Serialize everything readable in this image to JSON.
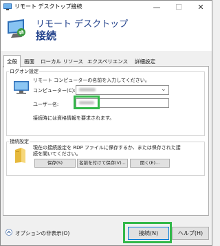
{
  "window": {
    "title": "リモート デスクトップ接続",
    "close": "✕",
    "minimize": "—",
    "maximize": "☐"
  },
  "banner": {
    "title": "リモート デスクトップ",
    "subtitle": "接続"
  },
  "tabs": [
    {
      "label": "全般",
      "active": true
    },
    {
      "label": "画面"
    },
    {
      "label": "ローカル リソース"
    },
    {
      "label": "エクスペリエンス"
    },
    {
      "label": "詳細設定"
    }
  ],
  "logon": {
    "group_label": "ログオン設定",
    "prompt": "リモート コンピューターの名前を入力してください。",
    "computer_label": "コンピューター(C):",
    "computer_value": "",
    "user_label": "ユーザー名:",
    "user_value": "",
    "note": "接続時には資格情報を要求されます。"
  },
  "connection": {
    "group_label": "接続設定",
    "text_line1": "現在の接続設定を RDP ファイルに保存するか、または保存された接",
    "text_line2": "続を開いてください。",
    "save_button": "保存(S)",
    "save_as_button": "名前を付けて保存(V)...",
    "open_button": "開く(E)..."
  },
  "footer": {
    "options_label": "オプションの非表示(O)",
    "connect_button": "接続(N)",
    "help_button": "ヘルプ(H)"
  },
  "colors": {
    "accent_green": "#33b84a",
    "banner_text": "#1f3f8a"
  }
}
